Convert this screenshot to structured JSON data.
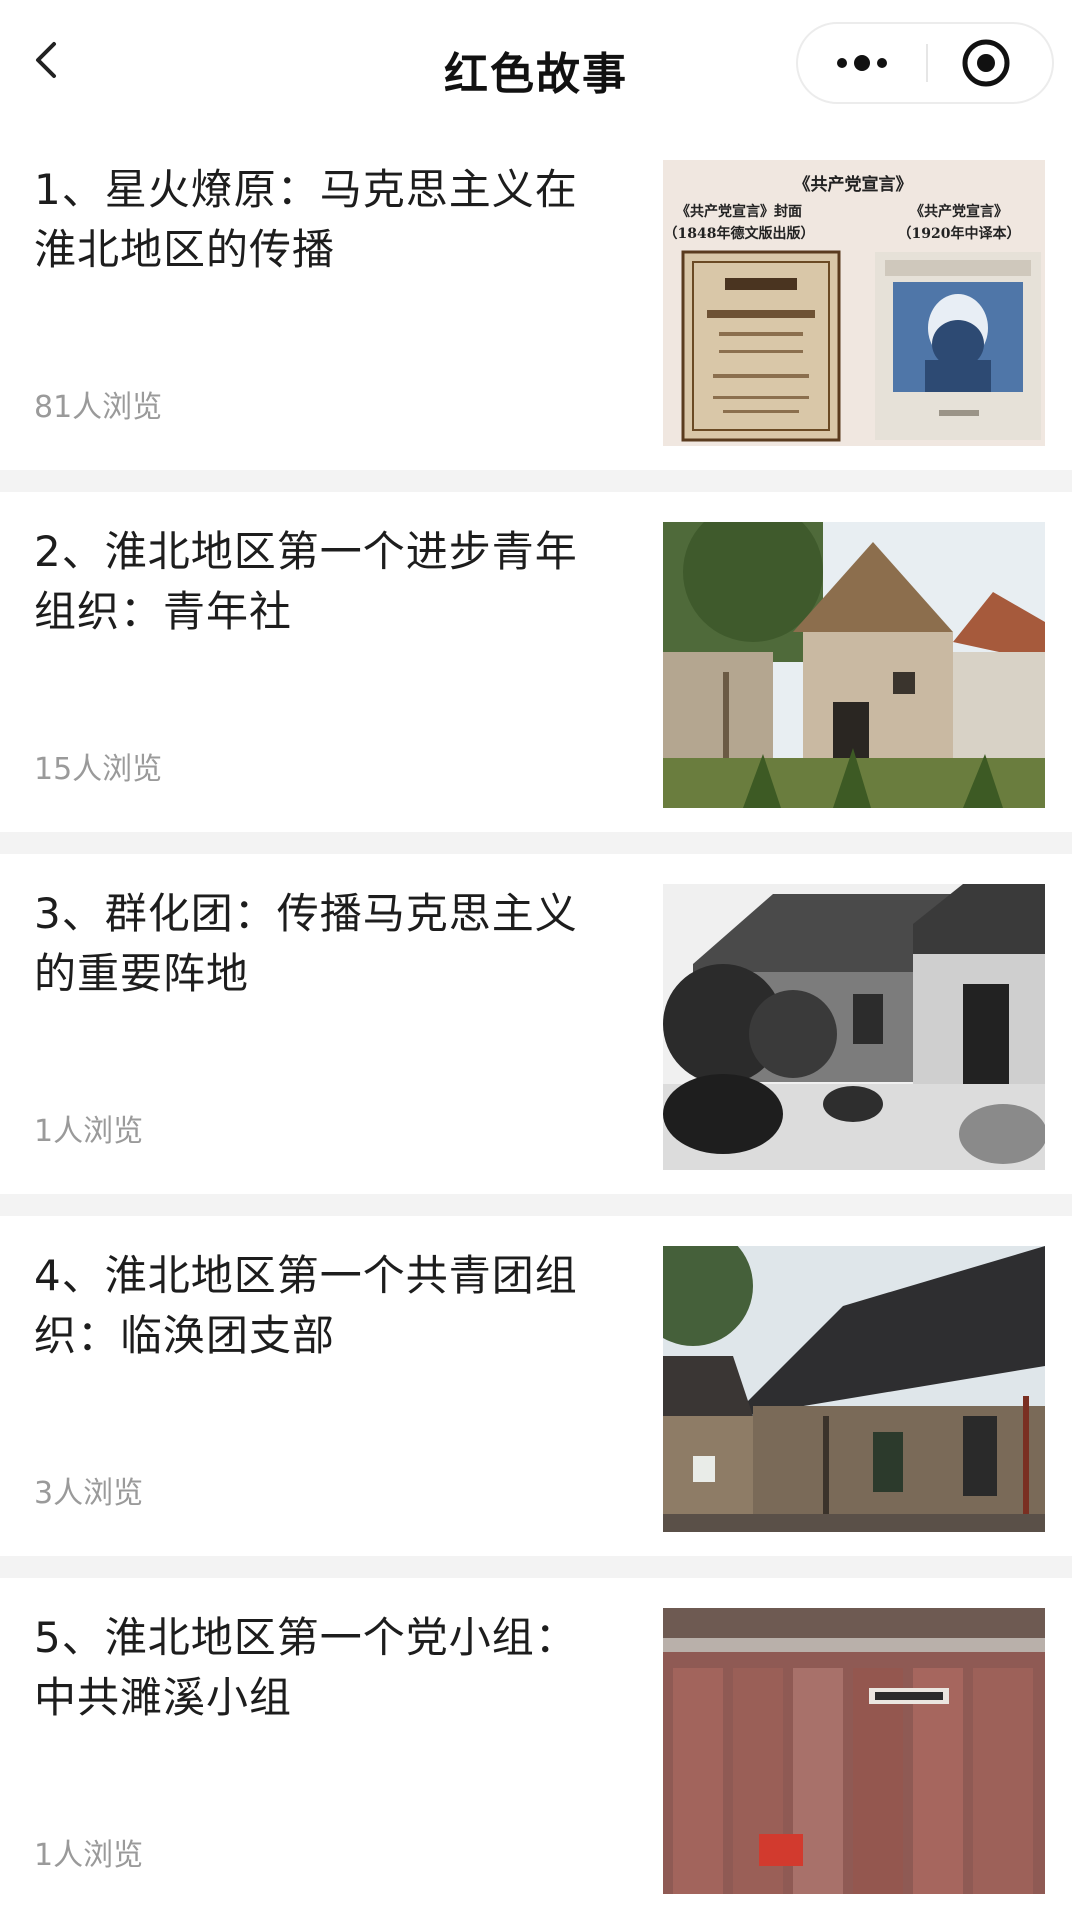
{
  "nav": {
    "title": "红色故事",
    "back_icon": "chevron-left-icon",
    "more_icon": "ellipsis-icon",
    "close_icon": "target-circle-icon"
  },
  "stories": [
    {
      "title": "1、星火燎原：马克思主义在淮北地区的传播",
      "views": "81人浏览",
      "thumb": "communist-manifesto-covers",
      "thumb_captions": {
        "top": "《共产党宣言》",
        "left_1": "《共产党宣言》封面",
        "left_2": "（1848年德文版出版）",
        "right_1": "《共产党宣言》",
        "right_2": "（1920年中译本）"
      }
    },
    {
      "title": "2、淮北地区第一个进步青年组织：青年社",
      "views": "15人浏览",
      "thumb": "old-courtyard-house-photo"
    },
    {
      "title": "3、群化团：传播马克思主义的重要阵地",
      "views": "1人浏览",
      "thumb": "black-white-courtyard-photo"
    },
    {
      "title": "4、淮北地区第一个共青团组织：临涣团支部",
      "views": "3人浏览",
      "thumb": "old-brick-house-photo"
    },
    {
      "title": "5、淮北地区第一个党小组：中共濉溪小组",
      "views": "1人浏览",
      "thumb": "red-wooden-door-photo"
    }
  ],
  "colors": {
    "separator": "#f3f3f3",
    "views_text": "#9a9a9a",
    "title_text": "#1d1d1d"
  }
}
